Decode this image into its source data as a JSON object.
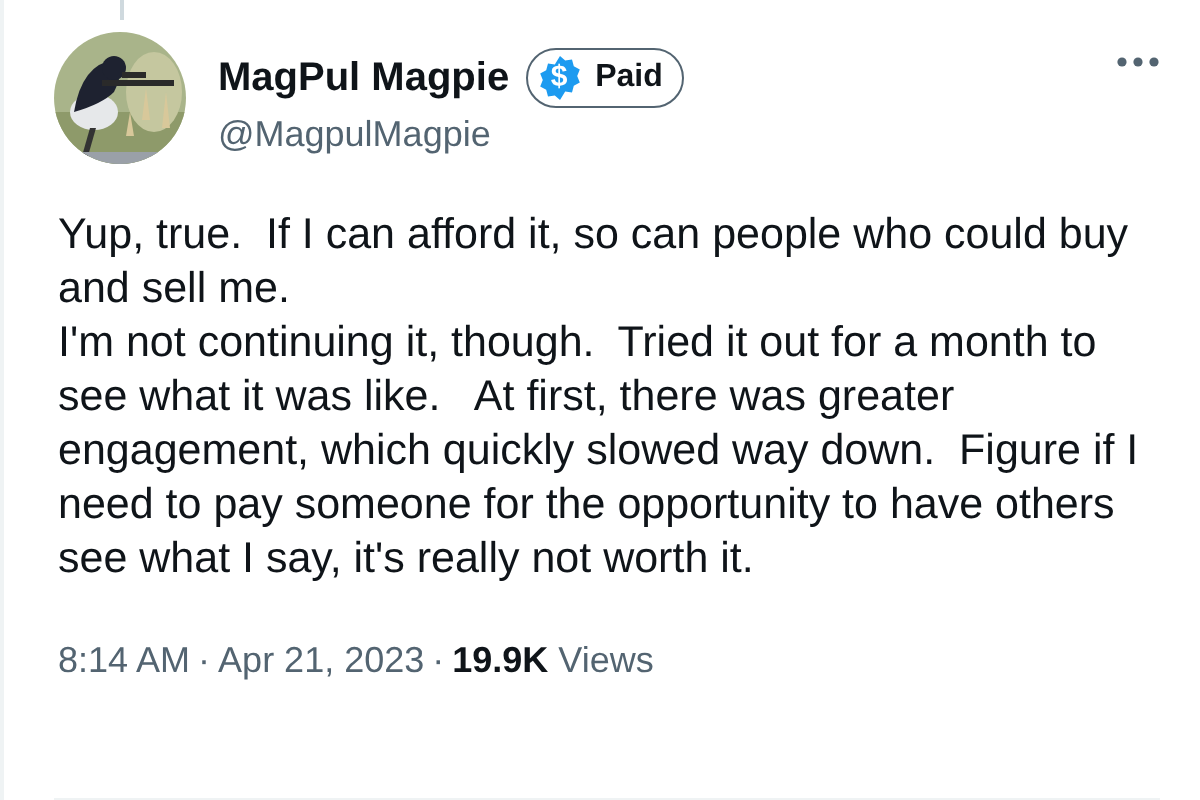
{
  "author": {
    "name": "MagPul Magpie",
    "badge": {
      "symbol": "$",
      "label": "Paid"
    },
    "handle": "@MagpulMagpie"
  },
  "body": [
    "Yup, true.  If I can afford it, so can people who could buy and sell me.",
    "I'm not continuing it, though.  Tried it out for a month to see what it was like.   At first, there was greater engagement, which quickly slowed way down.  Figure if I need to pay someone for the opportunity to have others see what I say, it's really not worth it."
  ],
  "meta": {
    "time": "8:14 AM",
    "separator_1": "·",
    "date": "Apr 21, 2023",
    "separator_2": "·",
    "views": "**19.9K** Views"
  }
}
